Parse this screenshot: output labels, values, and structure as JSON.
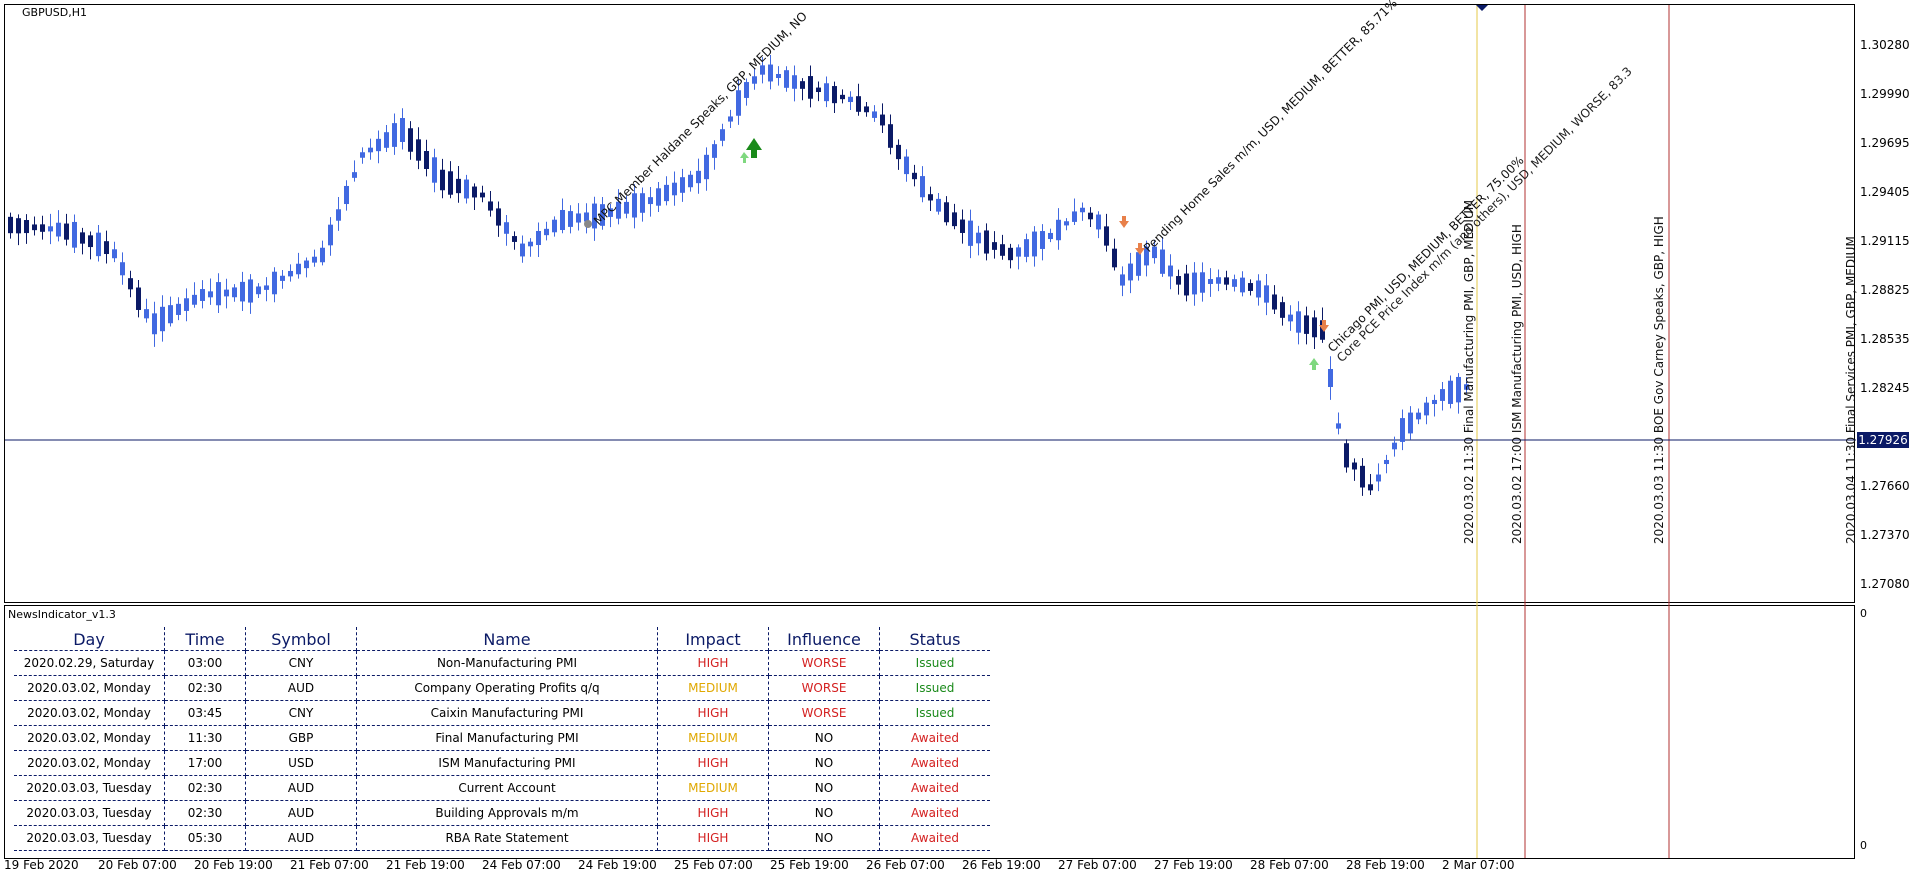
{
  "chart": {
    "symbol": "GBPUSD,H1",
    "price_labels": [
      "1.30280",
      "1.29990",
      "1.29695",
      "1.29405",
      "1.29115",
      "1.28825",
      "1.28535",
      "1.28245",
      "1.27660",
      "1.27370",
      "1.27080"
    ],
    "current_price": "1.27926",
    "time_labels": [
      "19 Feb 2020",
      "20 Feb 07:00",
      "20 Feb 19:00",
      "21 Feb 07:00",
      "21 Feb 19:00",
      "24 Feb 07:00",
      "24 Feb 19:00",
      "25 Feb 07:00",
      "25 Feb 19:00",
      "26 Feb 07:00",
      "26 Feb 19:00",
      "27 Feb 07:00",
      "27 Feb 19:00",
      "28 Feb 07:00",
      "28 Feb 19:00",
      "2 Mar 07:00"
    ],
    "subwindow_labels": {
      "top": "0",
      "bottom": "0"
    },
    "colors": {
      "bull": "#4169e1",
      "bear": "#0b1a66",
      "future_line": "#e6c84a",
      "event_line": "#b03030"
    }
  },
  "annotations": {
    "diagonal": [
      "MPC Member Haldane Speaks, GBP, MEDIUM, NO",
      "Pending Home Sales m/m, USD, MEDIUM, BETTER, 85.71%",
      "Chicago PMI, USD, MEDIUM, BETTER, 75.00%",
      "Core PCE Price Index m/m (and others), USD, MEDIUM, WORSE, 83.3"
    ],
    "vertical": [
      "2020.03.02 11:30 Final Manufacturing PMI, GBP, MEDIUM",
      "2020.03.02 17:00 ISM Manufacturing PMI, USD, HIGH",
      "2020.03.03 11:30 BOE Gov Carney Speaks, GBP, HIGH",
      "2020.03.04 11:30 Final Services PMI, GBP, MEDIUM"
    ]
  },
  "indicator": {
    "title": "NewsIndicator_v1.3",
    "columns": [
      "Day",
      "Time",
      "Symbol",
      "Name",
      "Impact",
      "Influence",
      "Status"
    ],
    "rows": [
      {
        "day": "2020.02.29, Saturday",
        "time": "03:00",
        "symbol": "CNY",
        "name": "Non-Manufacturing PMI",
        "impact": "HIGH",
        "influence": "WORSE",
        "status": "Issued"
      },
      {
        "day": "2020.03.02, Monday",
        "time": "02:30",
        "symbol": "AUD",
        "name": "Company Operating Profits q/q",
        "impact": "MEDIUM",
        "influence": "WORSE",
        "status": "Issued"
      },
      {
        "day": "2020.03.02, Monday",
        "time": "03:45",
        "symbol": "CNY",
        "name": "Caixin Manufacturing PMI",
        "impact": "HIGH",
        "influence": "WORSE",
        "status": "Issued"
      },
      {
        "day": "2020.03.02, Monday",
        "time": "11:30",
        "symbol": "GBP",
        "name": "Final Manufacturing PMI",
        "impact": "MEDIUM",
        "influence": "NO",
        "status": "Awaited"
      },
      {
        "day": "2020.03.02, Monday",
        "time": "17:00",
        "symbol": "USD",
        "name": "ISM Manufacturing PMI",
        "impact": "HIGH",
        "influence": "NO",
        "status": "Awaited"
      },
      {
        "day": "2020.03.03, Tuesday",
        "time": "02:30",
        "symbol": "AUD",
        "name": "Current Account",
        "impact": "MEDIUM",
        "influence": "NO",
        "status": "Awaited"
      },
      {
        "day": "2020.03.03, Tuesday",
        "time": "02:30",
        "symbol": "AUD",
        "name": "Building Approvals m/m",
        "impact": "HIGH",
        "influence": "NO",
        "status": "Awaited"
      },
      {
        "day": "2020.03.03, Tuesday",
        "time": "05:30",
        "symbol": "AUD",
        "name": "RBA Rate Statement",
        "impact": "HIGH",
        "influence": "NO",
        "status": "Awaited"
      }
    ],
    "colors": {
      "HIGH": "#d42020",
      "MEDIUM": "#e0a800",
      "WORSE": "#d42020",
      "NO": "#000000",
      "Issued": "#1a8a1a",
      "Awaited": "#d42020"
    }
  }
}
